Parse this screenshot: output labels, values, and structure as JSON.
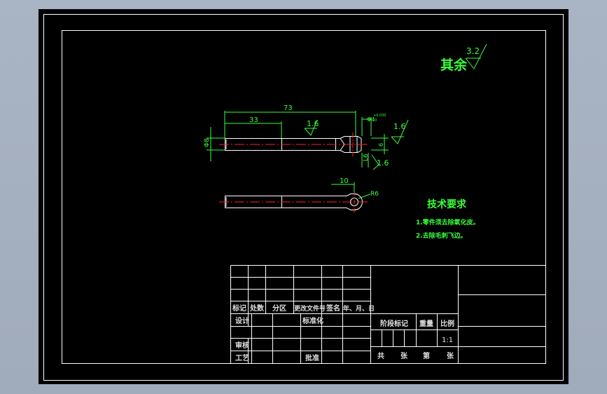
{
  "roughness": {
    "general_label": "其余",
    "general_value": "3.2",
    "upper_value": "1.6",
    "right_value": "1.6",
    "lower_value": "1.6"
  },
  "dimensions": {
    "overall_length": "73",
    "shank_length": "33",
    "tip_length": "L6",
    "bore_dia": "Φ4",
    "bore_tol_upper": "+0.030",
    "bore_tol_lower": "0",
    "shank_dia": "Φ8",
    "end_width": "6",
    "end_offset": "10",
    "end_radius": "R6"
  },
  "technical_requirements": {
    "title": "技术要求",
    "items": [
      "1.零件须去除氧化皮。",
      "2.去除毛刺飞边。"
    ]
  },
  "title_block": {
    "col_labels": [
      "标记",
      "处数",
      "分区",
      "更改文件号",
      "签名",
      "年、月、日"
    ],
    "designer_label": "设计",
    "standardize_label": "标准化",
    "stage_mark_label": "阶段标记",
    "weight_label": "重量",
    "scale_label": "比例",
    "scale_value": "1:1",
    "review_label": "审核",
    "process_label": "工艺",
    "approve_label": "批准",
    "sheet_total_label": "共",
    "sheet_unit_label": "张",
    "sheet_no_label": "第",
    "sheet_unit2_label": "张"
  },
  "colors": {
    "drawing_lines": "#ffffff",
    "dimension": "#39ff3a",
    "centerline": "#ff2020",
    "sheet_background": "#000000",
    "viewport_background": "#a5b0c0"
  }
}
